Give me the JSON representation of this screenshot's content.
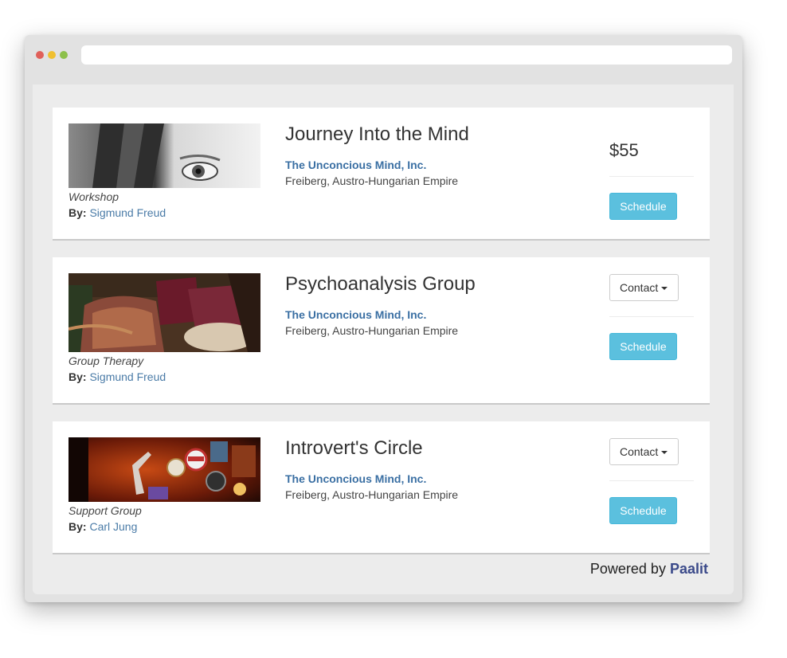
{
  "theme": {
    "dot_colors": [
      "#e0605a",
      "#f0c030",
      "#8cc04a"
    ],
    "accent": "#5bc0de",
    "link_color": "#4a7ba7",
    "brand_color": "#3b4a8a"
  },
  "cards": [
    {
      "thumbnail": "woman-eye-photo",
      "category": "Workshop",
      "by_label": "By:",
      "author": "Sigmund Freud",
      "title": "Journey Into the Mind",
      "organization": "The Unconcious Mind, Inc.",
      "location": "Freiberg, Austro-Hungarian Empire",
      "price": "$55",
      "schedule_label": "Schedule"
    },
    {
      "thumbnail": "therapy-couch-photo",
      "category": "Group Therapy",
      "by_label": "By:",
      "author": "Sigmund Freud",
      "title": "Psychoanalysis Group",
      "organization": "The Unconcious Mind, Inc.",
      "location": "Freiberg, Austro-Hungarian Empire",
      "contact_label": "Contact",
      "schedule_label": "Schedule"
    },
    {
      "thumbnail": "bar-wall-signs-photo",
      "category": "Support Group",
      "by_label": "By:",
      "author": "Carl Jung",
      "title": "Introvert's Circle",
      "organization": "The Unconcious Mind, Inc.",
      "location": "Freiberg, Austro-Hungarian Empire",
      "contact_label": "Contact",
      "schedule_label": "Schedule"
    }
  ],
  "footer": {
    "powered_text": "Powered by",
    "brand": "Paalit"
  }
}
